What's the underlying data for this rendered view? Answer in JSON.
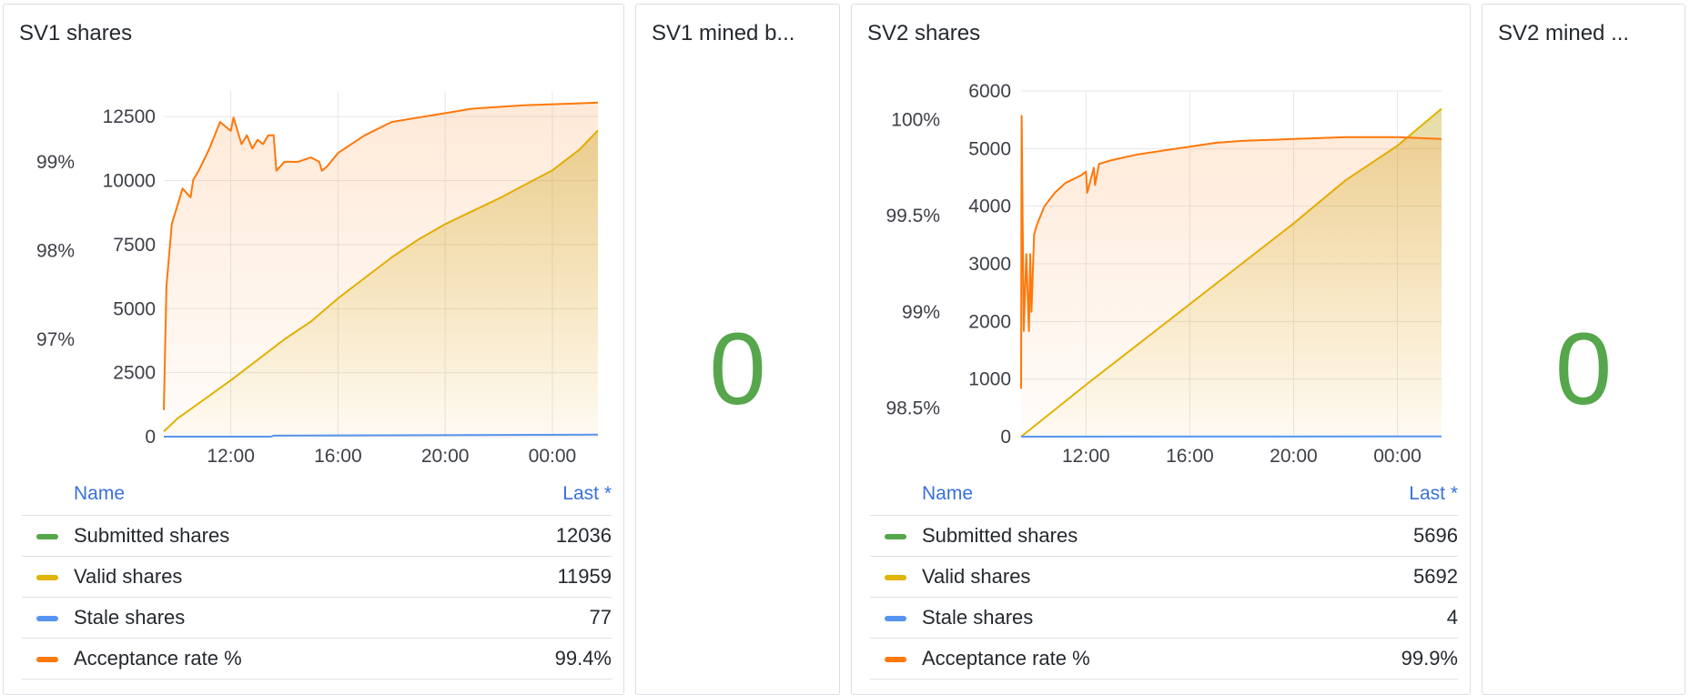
{
  "panels": {
    "sv1_shares": {
      "title": "SV1 shares",
      "legend": {
        "name_header": "Name",
        "last_header": "Last *",
        "rows": [
          {
            "name": "Submitted shares",
            "value": "12036",
            "color": "#56a64b"
          },
          {
            "name": "Valid shares",
            "value": "11959",
            "color": "#e0b400"
          },
          {
            "name": "Stale shares",
            "value": "77",
            "color": "#5794f2"
          },
          {
            "name": "Acceptance rate %",
            "value": "99.4%",
            "color": "#ff780a"
          }
        ]
      }
    },
    "sv1_mined": {
      "title": "SV1 mined b...",
      "value": "0",
      "color": "#56a64b"
    },
    "sv2_shares": {
      "title": "SV2 shares",
      "legend": {
        "name_header": "Name",
        "last_header": "Last *",
        "rows": [
          {
            "name": "Submitted shares",
            "value": "5696",
            "color": "#56a64b"
          },
          {
            "name": "Valid shares",
            "value": "5692",
            "color": "#e0b400"
          },
          {
            "name": "Stale shares",
            "value": "4",
            "color": "#5794f2"
          },
          {
            "name": "Acceptance rate %",
            "value": "99.9%",
            "color": "#ff780a"
          }
        ]
      }
    },
    "sv2_mined": {
      "title": "SV2 mined ...",
      "value": "0",
      "color": "#56a64b"
    }
  },
  "chart_data": [
    {
      "type": "line",
      "panel": "SV1 shares",
      "x_tick_labels": [
        "12:00",
        "16:00",
        "20:00",
        "00:00"
      ],
      "x_range_hours": [
        9.5,
        25.7
      ],
      "left_axis": {
        "ticks": [
          0,
          2500,
          5000,
          7500,
          10000,
          12500
        ],
        "ylim": [
          0,
          13500
        ]
      },
      "right_axis": {
        "ticks": [
          "97%",
          "98%",
          "99%"
        ],
        "tick_values": [
          97,
          98,
          99
        ],
        "ylim": [
          95.9,
          99.8
        ]
      },
      "series": [
        {
          "name": "Valid shares",
          "axis": "left",
          "color": "#e0b400",
          "x": [
            9.5,
            10,
            11,
            12,
            13,
            14,
            15,
            16,
            17,
            18,
            19,
            20,
            21,
            22,
            23,
            24,
            25,
            25.7
          ],
          "y": [
            200,
            700,
            1450,
            2200,
            3000,
            3800,
            4500,
            5400,
            6200,
            7000,
            7700,
            8300,
            8800,
            9300,
            9850,
            10400,
            11200,
            11959
          ]
        },
        {
          "name": "Stale shares",
          "axis": "left",
          "color": "#5794f2",
          "x": [
            9.5,
            13.5,
            13.6,
            25.7
          ],
          "y": [
            0,
            0,
            40,
            77
          ]
        },
        {
          "name": "Acceptance rate %",
          "axis": "right",
          "color": "#ff780a",
          "x": [
            9.5,
            9.6,
            9.8,
            10.2,
            10.5,
            10.6,
            10.8,
            11.2,
            11.6,
            12.0,
            12.1,
            12.4,
            12.6,
            12.8,
            13.0,
            13.2,
            13.4,
            13.6,
            13.7,
            14.0,
            14.5,
            15.0,
            15.3,
            15.4,
            15.6,
            16.0,
            17.0,
            18.0,
            19.0,
            20.0,
            21.0,
            22.0,
            23.0,
            24.0,
            25.0,
            25.7
          ],
          "y": [
            96.2,
            97.6,
            98.3,
            98.7,
            98.6,
            98.8,
            98.9,
            99.15,
            99.45,
            99.35,
            99.5,
            99.2,
            99.3,
            99.15,
            99.25,
            99.2,
            99.3,
            99.3,
            98.9,
            99.0,
            99.0,
            99.05,
            99.0,
            98.9,
            98.95,
            99.1,
            99.3,
            99.45,
            99.5,
            99.55,
            99.6,
            99.62,
            99.64,
            99.65,
            99.66,
            99.67
          ]
        }
      ]
    },
    {
      "type": "line",
      "panel": "SV2 shares",
      "x_tick_labels": [
        "12:00",
        "16:00",
        "20:00",
        "00:00"
      ],
      "x_range_hours": [
        9.5,
        25.7
      ],
      "left_axis": {
        "ticks": [
          0,
          1000,
          2000,
          3000,
          4000,
          5000,
          6000
        ],
        "ylim": [
          0,
          6000
        ]
      },
      "right_axis": {
        "ticks": [
          "98.5%",
          "99%",
          "99.5%",
          "100%"
        ],
        "tick_values": [
          98.5,
          99,
          99.5,
          100
        ],
        "ylim": [
          98.35,
          100.15
        ]
      },
      "series": [
        {
          "name": "Valid shares",
          "axis": "left",
          "color": "#e0b400",
          "x": [
            9.5,
            10,
            12,
            14,
            16,
            18,
            20,
            22,
            24,
            25.7
          ],
          "y": [
            0,
            180,
            900,
            1600,
            2300,
            3000,
            3700,
            4450,
            5050,
            5692
          ]
        },
        {
          "name": "Stale shares",
          "axis": "left",
          "color": "#5794f2",
          "x": [
            9.5,
            25.7
          ],
          "y": [
            0,
            4
          ]
        },
        {
          "name": "Acceptance rate %",
          "axis": "right",
          "color": "#ff780a",
          "x": [
            9.5,
            9.52,
            9.6,
            9.7,
            9.8,
            9.85,
            9.9,
            10.0,
            10.1,
            10.4,
            10.8,
            11.2,
            11.8,
            12.0,
            12.05,
            12.3,
            12.35,
            12.5,
            13.0,
            14.0,
            15.0,
            16.0,
            17.0,
            18.0,
            20.0,
            22.0,
            24.0,
            25.7
          ],
          "y": [
            98.6,
            100.02,
            98.9,
            99.3,
            98.9,
            99.3,
            99.0,
            99.4,
            99.45,
            99.55,
            99.62,
            99.67,
            99.71,
            99.73,
            99.62,
            99.75,
            99.66,
            99.77,
            99.79,
            99.82,
            99.84,
            99.86,
            99.88,
            99.89,
            99.9,
            99.91,
            99.91,
            99.9
          ]
        }
      ]
    }
  ]
}
